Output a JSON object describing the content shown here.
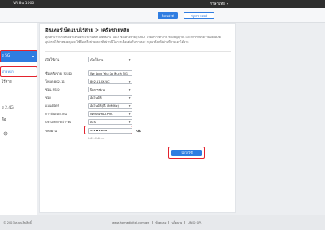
{
  "header": {
    "model": "VR 8u 1000",
    "language": "ภาษาไทย",
    "language_caret": "▾",
    "logout_label": "ล็อกเอ้าท์",
    "reboot_label": "รีบูตเราเตอร์"
  },
  "sidebar": {
    "items": [
      {
        "label": "ย 5G",
        "caret": "▾"
      },
      {
        "label": "ข่ายหลัก"
      },
      {
        "label": "ไร้สาย"
      },
      {
        "label": "ย 2.4G"
      },
      {
        "label": "ลือ"
      }
    ],
    "bottom_icon": "gear-icon"
  },
  "page": {
    "title": "อินเทอร์เน็ตแบบไร้สาย > เครือข่ายหลัก",
    "description": "คุณสามารถกำหนดค่าเครือข่ายไร้สายหลักได้ที่หน้านี้ ได้แก่ ชื่อเครือข่าย (SSID) โหมดการทำงาน ช่องสัญญาณ และการรักษาความปลอดภัย อุปกรณ์ไร้สายของคุณจะใช้ชื่อเครือข่ายและรหัสผ่านนี้ในการเชื่อมต่อกับเราเตอร์ กรุณาตั้งรหัสผ่านที่คาดเดาได้ยาก"
  },
  "form": {
    "rows": [
      {
        "label": "เปิดใช้งาน",
        "value": "เปิดใช้งาน",
        "caret": "▾"
      },
      {
        "label": "ชื่อเครือข่าย (SSID)",
        "value": "We Love You So Much_5G"
      },
      {
        "label": "โหมด 802.11",
        "value": "802.11AX/AC",
        "caret": "▾"
      },
      {
        "label": "ซ่อน SSID",
        "value": "ปิดการซ่อน",
        "caret": "▾"
      },
      {
        "label": "ช่อง",
        "value": "อัตโนมัติ",
        "caret": "▾"
      },
      {
        "label": "แบนด์วิดท์",
        "value": "อัตโนมัติ (ถึง 80MHz)",
        "caret": "▾"
      },
      {
        "label": "การยืนยันตัวตน",
        "value": "WPA/WPA2-PSK",
        "caret": "▾"
      },
      {
        "label": "ประเภทการเข้ารหัส",
        "value": "AES",
        "caret": "▾"
      }
    ],
    "password": {
      "label": "รหัสผ่าน",
      "value": "••••••••••",
      "hint": "8-63 ตัวอักษร",
      "toggle_icon": "eye-icon"
    },
    "apply_label": "นำไปใช้"
  },
  "footer": {
    "copyright": "© 2023 สงวนลิขสิทธิ์",
    "links": [
      "www.homedigital.com/gw",
      "ข้อตกลง",
      "นโยบาย",
      "UNIQ GPL"
    ]
  },
  "colors": {
    "accent": "#2f7de1",
    "annotation": "#e3222d",
    "header_dark": "#2e2e2e"
  }
}
